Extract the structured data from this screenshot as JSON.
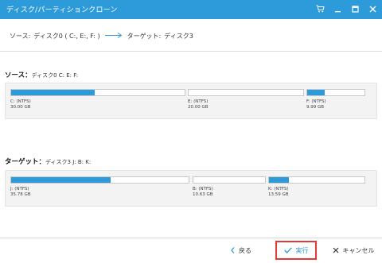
{
  "window": {
    "title": "ディスク/パーティションクローン",
    "controls": [
      "cart-icon",
      "minimize-icon",
      "maximize-icon",
      "close-icon"
    ]
  },
  "breadcrumb": {
    "source_label": "ソース:",
    "source_value": "ディスク0 ( C:, E:, F: )",
    "dest_label": "ターゲット:",
    "dest_value": "ディスク3"
  },
  "source": {
    "heading": "ソース：",
    "disk": "ディスク0 C: E: F:",
    "partitions": [
      {
        "name": "C: (NTFS)",
        "size": "30.00 GB",
        "used_fraction": 0.48
      },
      {
        "name": "E: (NTFS)",
        "size": "20.00 GB",
        "used_fraction": 0.0
      },
      {
        "name": "F: (NTFS)",
        "size": "9.99 GB",
        "used_fraction": 0.3
      }
    ]
  },
  "target": {
    "heading": "ターゲット：",
    "disk": "ディスク3 J: B: K:",
    "partitions": [
      {
        "name": "J: (NTFS)",
        "size": "35.78 GB",
        "used_fraction": 0.56
      },
      {
        "name": "B: (NTFS)",
        "size": "10.63 GB",
        "used_fraction": 0.0
      },
      {
        "name": "K: (NTFS)",
        "size": "13.59 GB",
        "used_fraction": 0.21
      }
    ]
  },
  "footer": {
    "back_label": "戻る",
    "run_label": "実行",
    "cancel_label": "キャンセル"
  },
  "colors": {
    "accent": "#2d9bd9",
    "highlight_border": "#e53935"
  }
}
